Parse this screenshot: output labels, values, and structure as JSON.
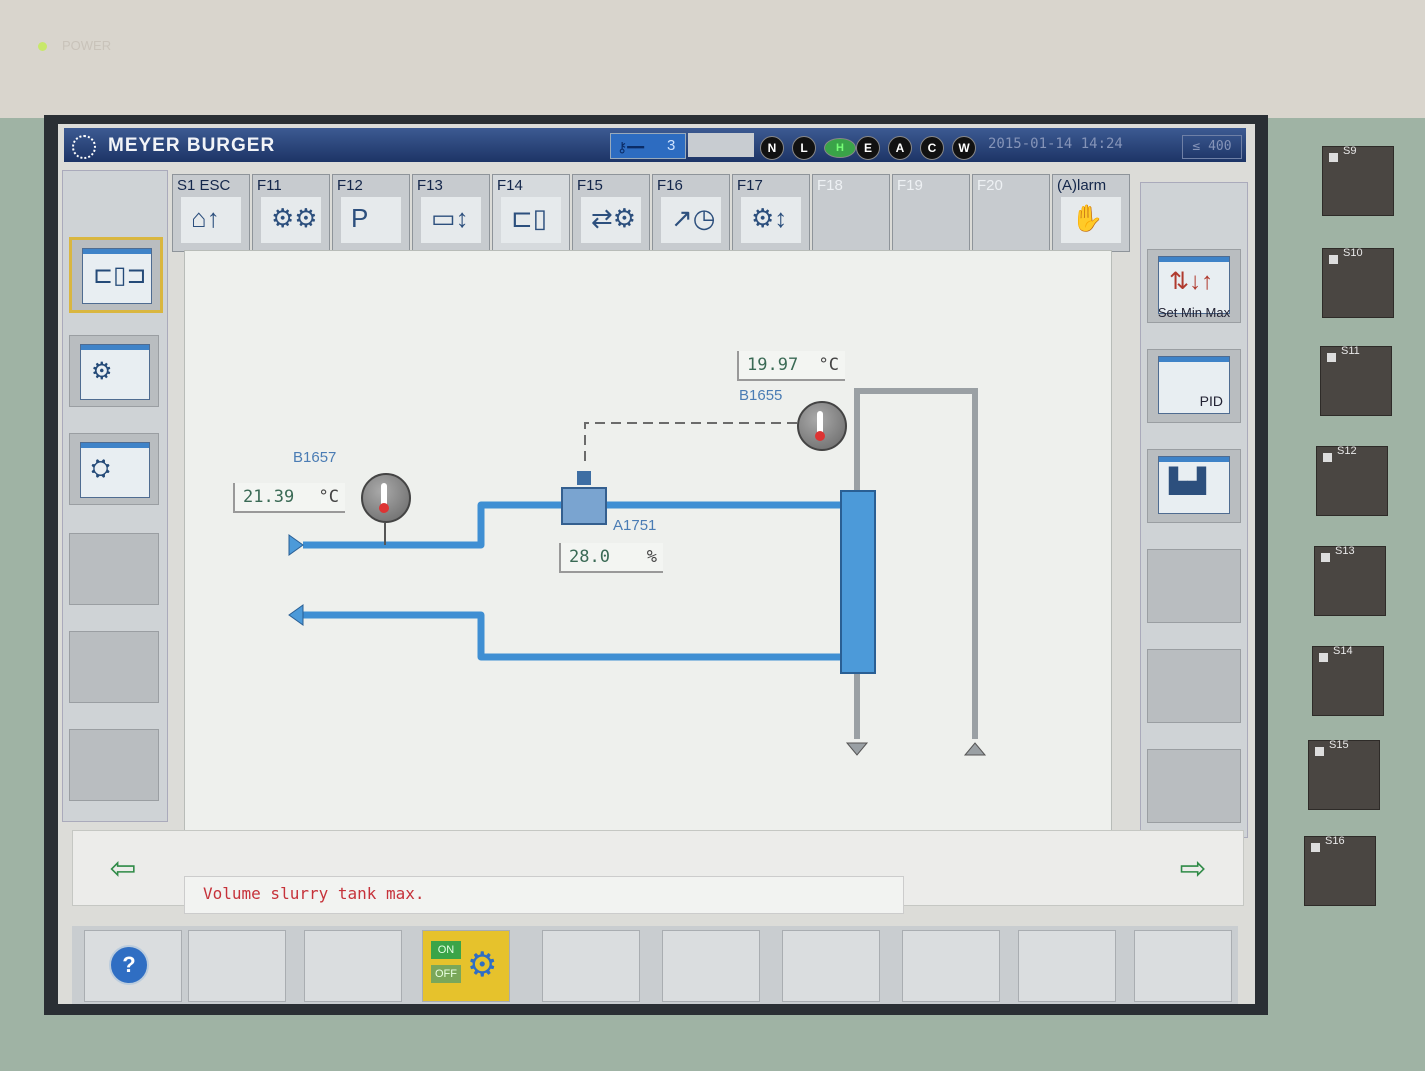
{
  "device": {
    "power_label": "POWER"
  },
  "header": {
    "brand": "MEYER BURGER",
    "user_level": "3",
    "modes": [
      "N",
      "L",
      "H",
      "E",
      "A",
      "C",
      "W"
    ],
    "datetime": "2015-01-14   14:24",
    "counter": "≤ 400"
  },
  "tabs": [
    {
      "label": "S1 ESC",
      "icon": "home-up-icon"
    },
    {
      "label": "F11",
      "icon": "conveyor-icon"
    },
    {
      "label": "F12",
      "icon": "parking-icon"
    },
    {
      "label": "F13",
      "icon": "monitor-lift-icon"
    },
    {
      "label": "F14",
      "icon": "heat-exchanger-icon"
    },
    {
      "label": "F15",
      "icon": "pump-filter-icon"
    },
    {
      "label": "F16",
      "icon": "trend-clock-icon"
    },
    {
      "label": "F17",
      "icon": "motor-icon"
    },
    {
      "label": "F18",
      "icon": ""
    },
    {
      "label": "F19",
      "icon": ""
    },
    {
      "label": "F20",
      "icon": ""
    },
    {
      "label": "(A)larm",
      "icon": "alarm-hand-icon"
    }
  ],
  "right_buttons": [
    {
      "label": "Set Min Max"
    },
    {
      "label": "PID"
    }
  ],
  "process": {
    "b1657": {
      "tag": "B1657",
      "value": "21.39",
      "unit": "°C"
    },
    "b1655": {
      "tag": "B1655",
      "value": "19.97",
      "unit": "°C"
    },
    "a1751": {
      "tag": "A1751",
      "value": "28.0",
      "unit": "%"
    }
  },
  "message": "Volume slurry tank max.",
  "bottom": {
    "help": "?",
    "on": "ON",
    "off": "OFF"
  },
  "softkeys": [
    "S9",
    "S10",
    "S11",
    "S12",
    "S13",
    "S14",
    "S15",
    "S16"
  ],
  "colors": {
    "pipe": "#3f8fd3",
    "alarm_text": "#c6323a",
    "brand_bar": "#1d3466"
  }
}
